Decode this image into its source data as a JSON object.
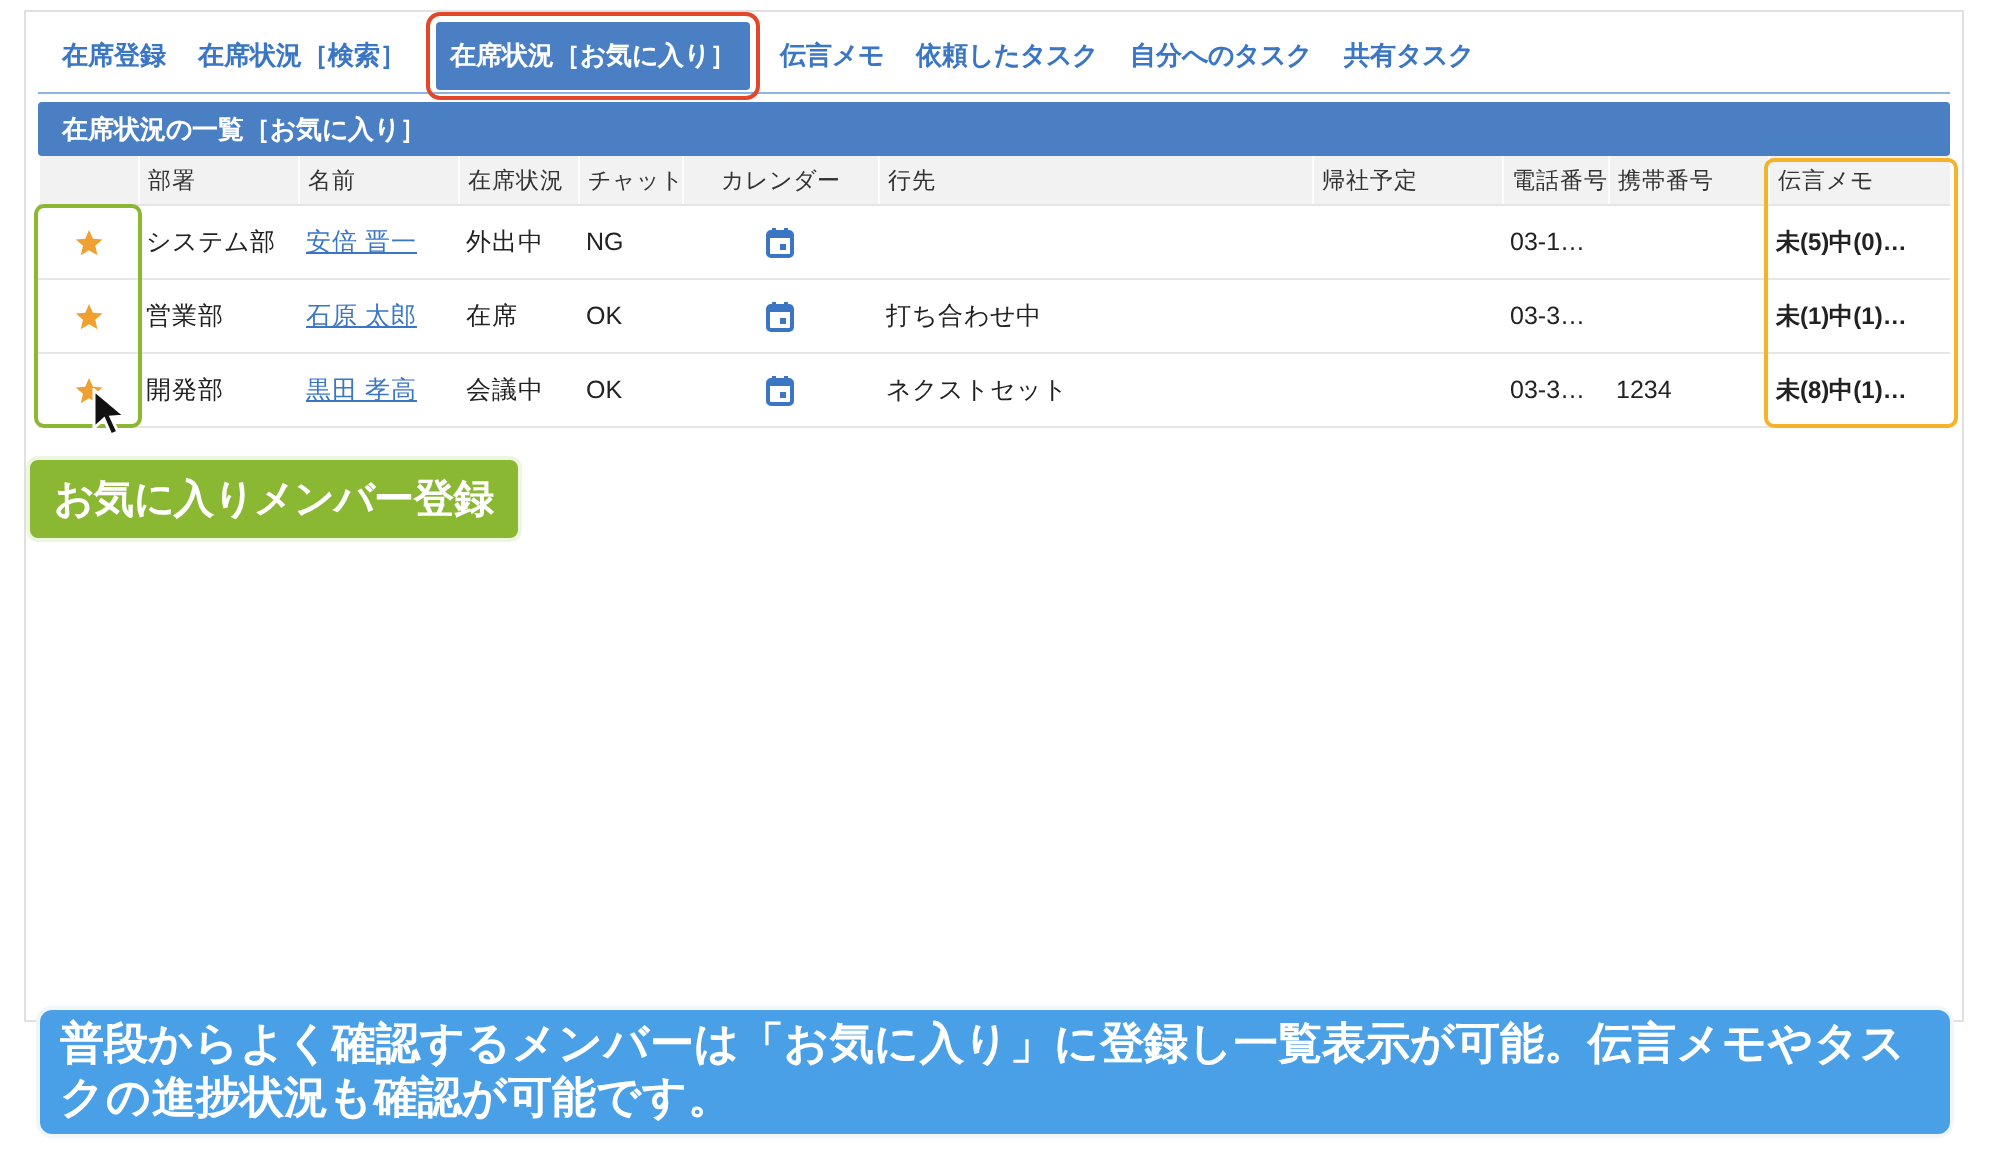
{
  "tabs": [
    {
      "label": "在席登録",
      "selected": false
    },
    {
      "label": "在席状況［検索］",
      "selected": false
    },
    {
      "label": "在席状況［お気に入り］",
      "selected": true
    },
    {
      "label": "伝言メモ",
      "selected": false
    },
    {
      "label": "依頼したタスク",
      "selected": false
    },
    {
      "label": "自分へのタスク",
      "selected": false
    },
    {
      "label": "共有タスク",
      "selected": false
    }
  ],
  "panel": {
    "title": "在席状況の一覧［お気に入り］"
  },
  "table": {
    "columns": [
      "部署",
      "名前",
      "在席状況",
      "チャット",
      "カレンダー",
      "行先",
      "帰社予定",
      "電話番号",
      "携帯番号",
      "伝言メモ"
    ],
    "rows": [
      {
        "favorite": true,
        "department": "システム部",
        "name": "安倍 晋一",
        "status": "外出中",
        "chat": "NG",
        "destination": "",
        "return": "",
        "phone": "03-1…",
        "mobile": "",
        "memo": "未(5)中(0)…"
      },
      {
        "favorite": true,
        "department": "営業部",
        "name": "石原 太郎",
        "status": "在席",
        "chat": "OK",
        "destination": "打ち合わせ中",
        "return": "",
        "phone": "03-3…",
        "mobile": "",
        "memo": "未(1)中(1)…"
      },
      {
        "favorite": true,
        "department": "開発部",
        "name": "黒田 孝高",
        "status": "会議中",
        "chat": "OK",
        "destination": "ネクストセット",
        "return": "",
        "phone": "03-3…",
        "mobile": "1234",
        "memo": "未(8)中(1)…"
      }
    ]
  },
  "callout_label": "お気に入りメンバー登録",
  "caption": "普段からよく確認するメンバーは「お気に入り」に登録し一覧表示が可能。伝言メモやタスクの進捗状況も確認が可能です。"
}
